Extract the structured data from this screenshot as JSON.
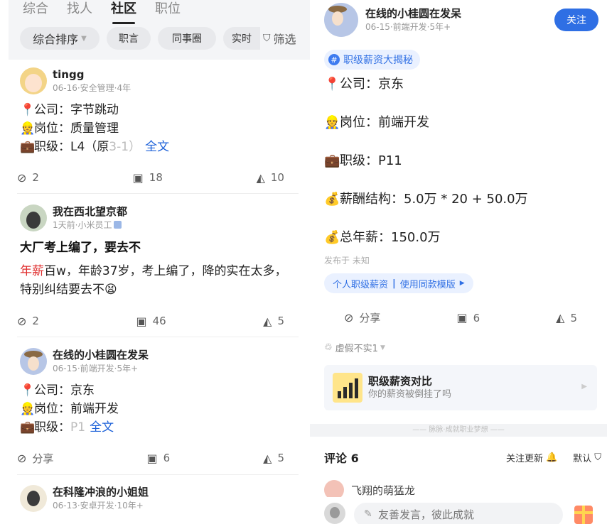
{
  "left": {
    "tabs": [
      {
        "label": "综合"
      },
      {
        "label": "找人"
      },
      {
        "label": "社区"
      },
      {
        "label": "职位"
      }
    ],
    "sort_label": "综合排序",
    "chips": [
      "职言",
      "同事圈",
      "实时"
    ],
    "filter_label": "筛选",
    "posts": [
      {
        "name": "tingg",
        "meta": "06-16·安全管理·4年",
        "lines": [
          "公司：字节跳动",
          "岗位：质量管理"
        ],
        "level_prefix": "职级：L4（原",
        "level_fade": "3-1）",
        "more": "全文",
        "like": "2",
        "comment": "18",
        "share": "10"
      },
      {
        "name": "我在西北望京都",
        "meta": "1天前·小米员工",
        "title": "大厂考上编了，要去不",
        "red_word": "年薪",
        "body": "百w，年龄37岁，考上编了，降的实在太多，特别纠结要去不😫",
        "like": "2",
        "comment": "46",
        "share": "5"
      },
      {
        "name": "在线的小桂圆在发呆",
        "meta": "06-15·前端开发·5年+",
        "lines": [
          "公司：京东",
          "岗位：前端开发"
        ],
        "level_prefix": "职级：",
        "level_fade": "P1",
        "more": "全文",
        "like": "分享",
        "comment": "6",
        "share": "5"
      },
      {
        "name": "在科隆冲浪的小姐姐",
        "meta": "06-13·安卓开发·10年+"
      }
    ]
  },
  "right": {
    "name": "在线的小桂圆在发呆",
    "meta": "06-15·前端开发·5年+",
    "follow": "关注",
    "topic": "职级薪资大揭秘",
    "lines": [
      {
        "emoji": "📍",
        "text": "公司：京东"
      },
      {
        "emoji": "👷",
        "text": "岗位：前端开发"
      },
      {
        "emoji": "💼",
        "text": "职级：P11"
      },
      {
        "emoji": "💰",
        "text": "薪酬结构：5.0万 * 20 + 50.0万"
      },
      {
        "emoji": "💰",
        "text": "总年薪：150.0万"
      }
    ],
    "posted": "发布于 未知",
    "template_left": "个人职级薪资",
    "template_right": "使用同款模版",
    "share": "分享",
    "comment": "6",
    "likes": "5",
    "report": "虚假不实1",
    "compare_title": "职级薪资对比",
    "compare_sub": "你的薪资被倒挂了吗",
    "slogan": "—— 脉脉·成就职业梦想 ——",
    "comments_title": "评论 6",
    "follow_updates": "关注更新",
    "default_sort": "默认",
    "commenter": "飞翔的萌猛龙",
    "input_placeholder": "友善发言，彼此成就"
  },
  "colors": {
    "accent": "#2f6fe4",
    "red": "#e03030",
    "more_link": "#1e62d9"
  }
}
